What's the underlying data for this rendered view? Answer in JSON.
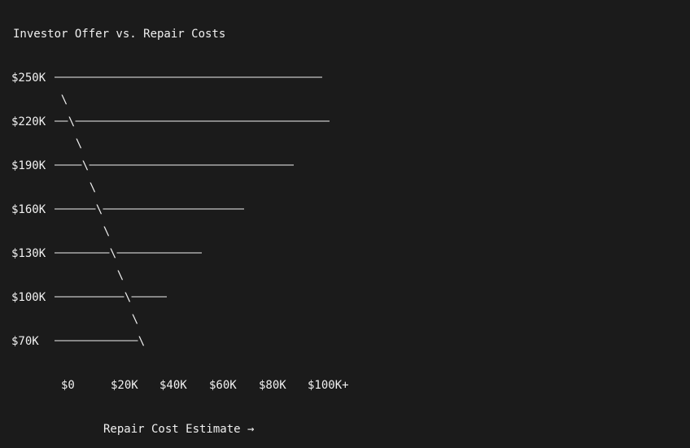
{
  "chart_data": {
    "type": "line",
    "title": "Investor Offer vs. Repair Costs",
    "xlabel": "Repair Cost Estimate →",
    "ylabel": "",
    "y_tick_labels": [
      "$250K",
      "$220K",
      "$190K",
      "$160K",
      "$130K",
      "$100K",
      "$70K"
    ],
    "x_tick_labels": [
      "$0",
      "$20K",
      "$40K",
      "$60K",
      "$80K",
      "$100K+"
    ],
    "offer_levels": [
      250,
      220,
      190,
      160,
      130,
      100,
      70
    ],
    "diagonal_glyph": "\\",
    "colors": {
      "background": "#1b1b1b",
      "foreground": "#f0f0f0"
    }
  }
}
